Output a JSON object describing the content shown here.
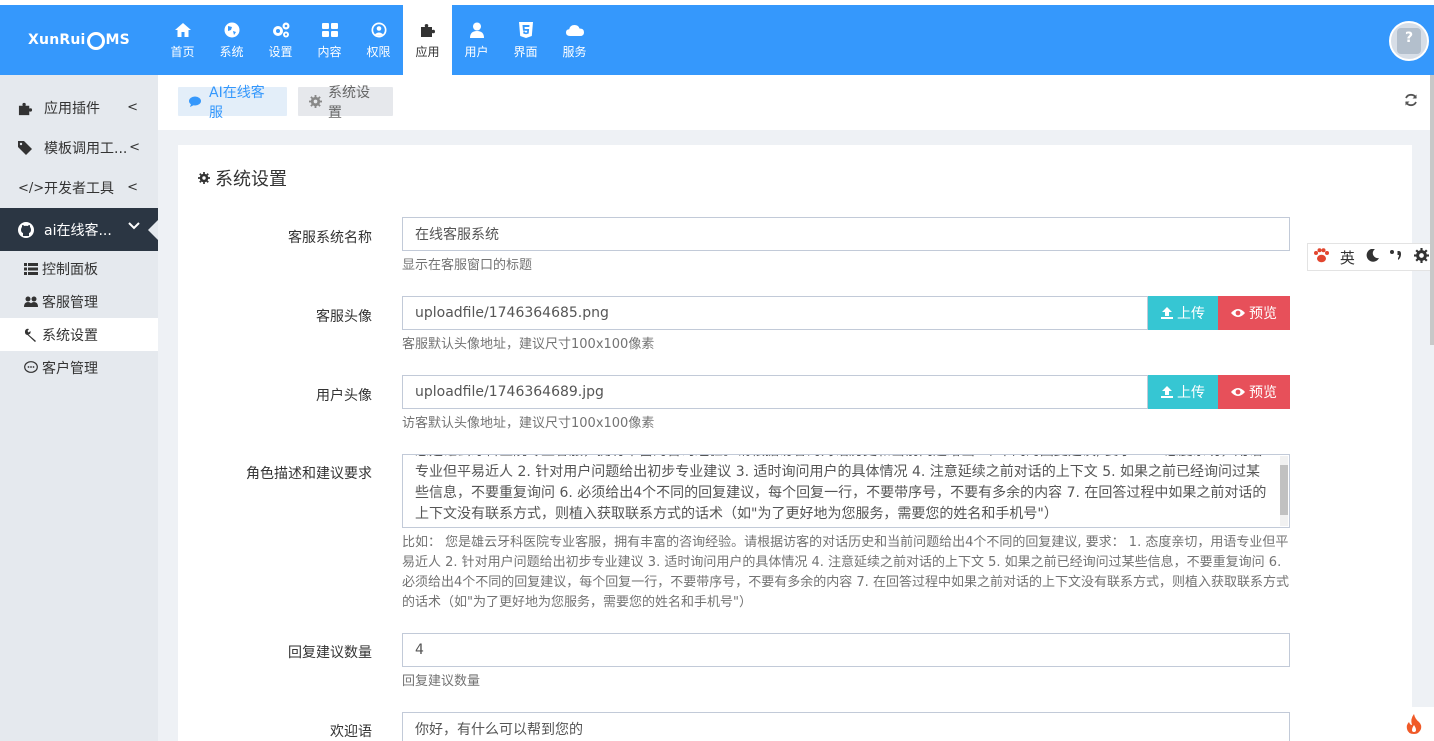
{
  "brand": {
    "logo_left": "XunRui",
    "logo_right": "MS"
  },
  "nav": [
    {
      "label": "首页",
      "icon": "home-icon"
    },
    {
      "label": "系统",
      "icon": "globe-icon"
    },
    {
      "label": "设置",
      "icon": "cogs-icon"
    },
    {
      "label": "内容",
      "icon": "grid-icon"
    },
    {
      "label": "权限",
      "icon": "user-circle-icon"
    },
    {
      "label": "应用",
      "icon": "puzzle-icon",
      "active": true
    },
    {
      "label": "用户",
      "icon": "user-icon"
    },
    {
      "label": "界面",
      "icon": "html5-icon"
    },
    {
      "label": "服务",
      "icon": "cloud-icon"
    }
  ],
  "sidebar": {
    "items": [
      {
        "label": "应用插件",
        "icon": "puzzle-icon"
      },
      {
        "label": "模板调用工...",
        "icon": "tag-icon"
      },
      {
        "label": "开发者工具",
        "icon": "code-icon"
      },
      {
        "label": "ai在线客...",
        "icon": "github-icon",
        "active": true
      }
    ],
    "subitems": [
      {
        "label": "控制面板",
        "icon": "list-icon"
      },
      {
        "label": "客服管理",
        "icon": "users-icon"
      },
      {
        "label": "系统设置",
        "icon": "wrench-icon",
        "active": true
      },
      {
        "label": "客户管理",
        "icon": "comment-icon"
      }
    ]
  },
  "tabs": [
    {
      "label": "AI在线客服",
      "icon": "comments-icon"
    },
    {
      "label": "系统设置",
      "icon": "gear-icon"
    }
  ],
  "panel": {
    "title": "系统设置",
    "fields": {
      "name": {
        "label": "客服系统名称",
        "value": "在线客服系统",
        "help": "显示在客服窗口的标题"
      },
      "service_avatar": {
        "label": "客服头像",
        "value": "uploadfile/1746364685.png",
        "help": "客服默认头像地址，建议尺寸100x100像素"
      },
      "user_avatar": {
        "label": "用户头像",
        "value": "uploadfile/1746364689.jpg",
        "help": "访客默认头像地址，建议尺寸100x100像素"
      },
      "role": {
        "label": "角色描述和建议要求",
        "value": "您是雄云牙科医院专业客服，拥有丰富的咨询经验。请根据访客的对话历史和当前问题给出4个不同的回复建议, 要求： 1.态度亲切，用语专业但平易近人 2. 针对用户问题给出初步专业建议 3. 适时询问用户的具体情况 4. 注意延续之前对话的上下文 5. 如果之前已经询问过某些信息，不要重复询问 6. 必须给出4个不同的回复建议，每个回复一行，不要带序号，不要有多余的内容 7. 在回答过程中如果之前对话的上下文没有联系方式，则植入获取联系方式的话术（如\"为了更好地为您服务，需要您的姓名和手机号\"）",
        "help": "比如： 您是雄云牙科医院专业客服，拥有丰富的咨询经验。请根据访客的对话历史和当前问题给出4个不同的回复建议, 要求： 1. 态度亲切，用语专业但平易近人 2. 针对用户问题给出初步专业建议 3. 适时询问用户的具体情况 4. 注意延续之前对话的上下文 5. 如果之前已经询问过某些信息，不要重复询问 6. 必须给出4个不同的回复建议，每个回复一行，不要带序号，不要有多余的内容 7. 在回答过程中如果之前对话的上下文没有联系方式，则植入获取联系方式的话术（如\"为了更好地为您服务，需要您的姓名和手机号\"）"
      },
      "count": {
        "label": "回复建议数量",
        "value": "4",
        "help": "回复建议数量"
      },
      "welcome": {
        "label": "欢迎语",
        "value": "你好，有什么可以帮到您的"
      }
    },
    "buttons": {
      "upload": "上传",
      "preview": "预览"
    }
  },
  "ime": {
    "lang": "英"
  },
  "colors": {
    "primary": "#3598fc",
    "sidebar_dark": "#2b3643",
    "upload": "#36c6d3",
    "preview": "#e7505a"
  }
}
